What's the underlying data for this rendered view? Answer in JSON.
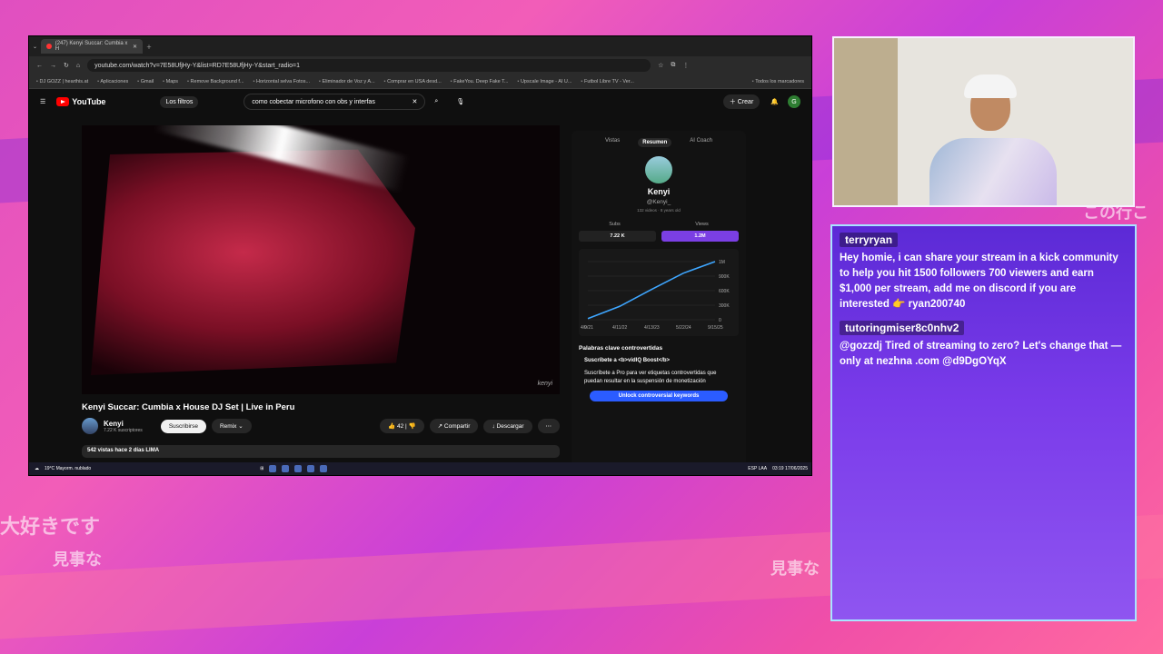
{
  "browser": {
    "tab_title": "(247) Kenyi Succar: Cumbia x H",
    "url": "youtube.com/watch?v=7E58UfjHy-Y&list=RD7E58UfjHy-Y&start_radio=1",
    "bookmarks": [
      "DJ GOZZ | hearthis.at",
      "Aplicaciones",
      "Gmail",
      "Maps",
      "Remove Background f...",
      "Horizontal selva Fotos...",
      "Eliminador de Voz y A...",
      "Comprar en USA desd...",
      "FakeYou. Deep Fake T...",
      "Upscale Image - AI U...",
      "Futbol Libre TV - Ver...",
      "Todos los marcadores"
    ]
  },
  "youtube": {
    "logo": "YouTube",
    "filter": "Los filtros",
    "search_query": "como cobectar microfono con obs y interfas",
    "create": "Crear",
    "user_initial": "G",
    "video_title": "Kenyi Succar: Cumbia x House DJ Set | Live in Peru",
    "channel": "Kenyi",
    "subscribers": "7.22 K suscriptores",
    "subscribe_label": "Suscribirse",
    "remix": "Remix",
    "likes": "42",
    "share": "Compartir",
    "download": "Descargar",
    "description": "542 vistas  hace 2 días  LIMA",
    "watermark": "kenyi"
  },
  "vidiq": {
    "tabs": [
      "Vistas",
      "Resumen",
      "AI Coach"
    ],
    "channel_name": "Kenyi",
    "handle": "@Kenyi_",
    "videos": "132 videos",
    "age": "8 years old",
    "subs_label": "Subs",
    "views_label": "Views",
    "subs_value": "7.22 K",
    "views_value": "1.2M",
    "keywords_title": "Palabras clave controvertidas",
    "promo_title": "Suscríbete a <b>vidIQ Boost</b>",
    "promo_text": "Suscríbete a Pro para ver etiquetas controvertidas que puedan resultar en la suspensión de monetización",
    "unlock": "Unlock controversial keywords"
  },
  "chart_data": {
    "type": "line",
    "x": [
      "4/9/21",
      "4/11/22",
      "4/13/23",
      "5/22/24",
      "9/15/25"
    ],
    "values": [
      20000,
      230000,
      520000,
      800000,
      1000000
    ],
    "yticks": [
      "1M",
      "900K",
      "600K",
      "300K",
      "0"
    ],
    "ylim": [
      0,
      1000000
    ]
  },
  "taskbar": {
    "weather": "19°C",
    "weather_desc": "Mayorm. nublado",
    "lang": "ESP LAA",
    "time": "03:19",
    "date": "17/06/2025"
  },
  "chat": {
    "messages": [
      {
        "user": "terryryan",
        "text": "Hey homie, i can share your stream in a kick community to help you hit 1500 followers 700 viewers and earn $1,000 per stream, add me on discord if you are interested 👉 ryan200740"
      },
      {
        "user": "tutoringmiser8c0nhv2",
        "text": "@gozzdj Tired of streaming to zero? Let's change that — only at nezhna .com @d9DgOYqX"
      }
    ]
  },
  "overlay_text": {
    "jp1": "大好きです",
    "jp2": "見事な",
    "jp3": "見事な",
    "jp4": "この行こ"
  },
  "colors": {
    "accent": "#7b3fe4",
    "chat_border": "#a8e4ff"
  }
}
